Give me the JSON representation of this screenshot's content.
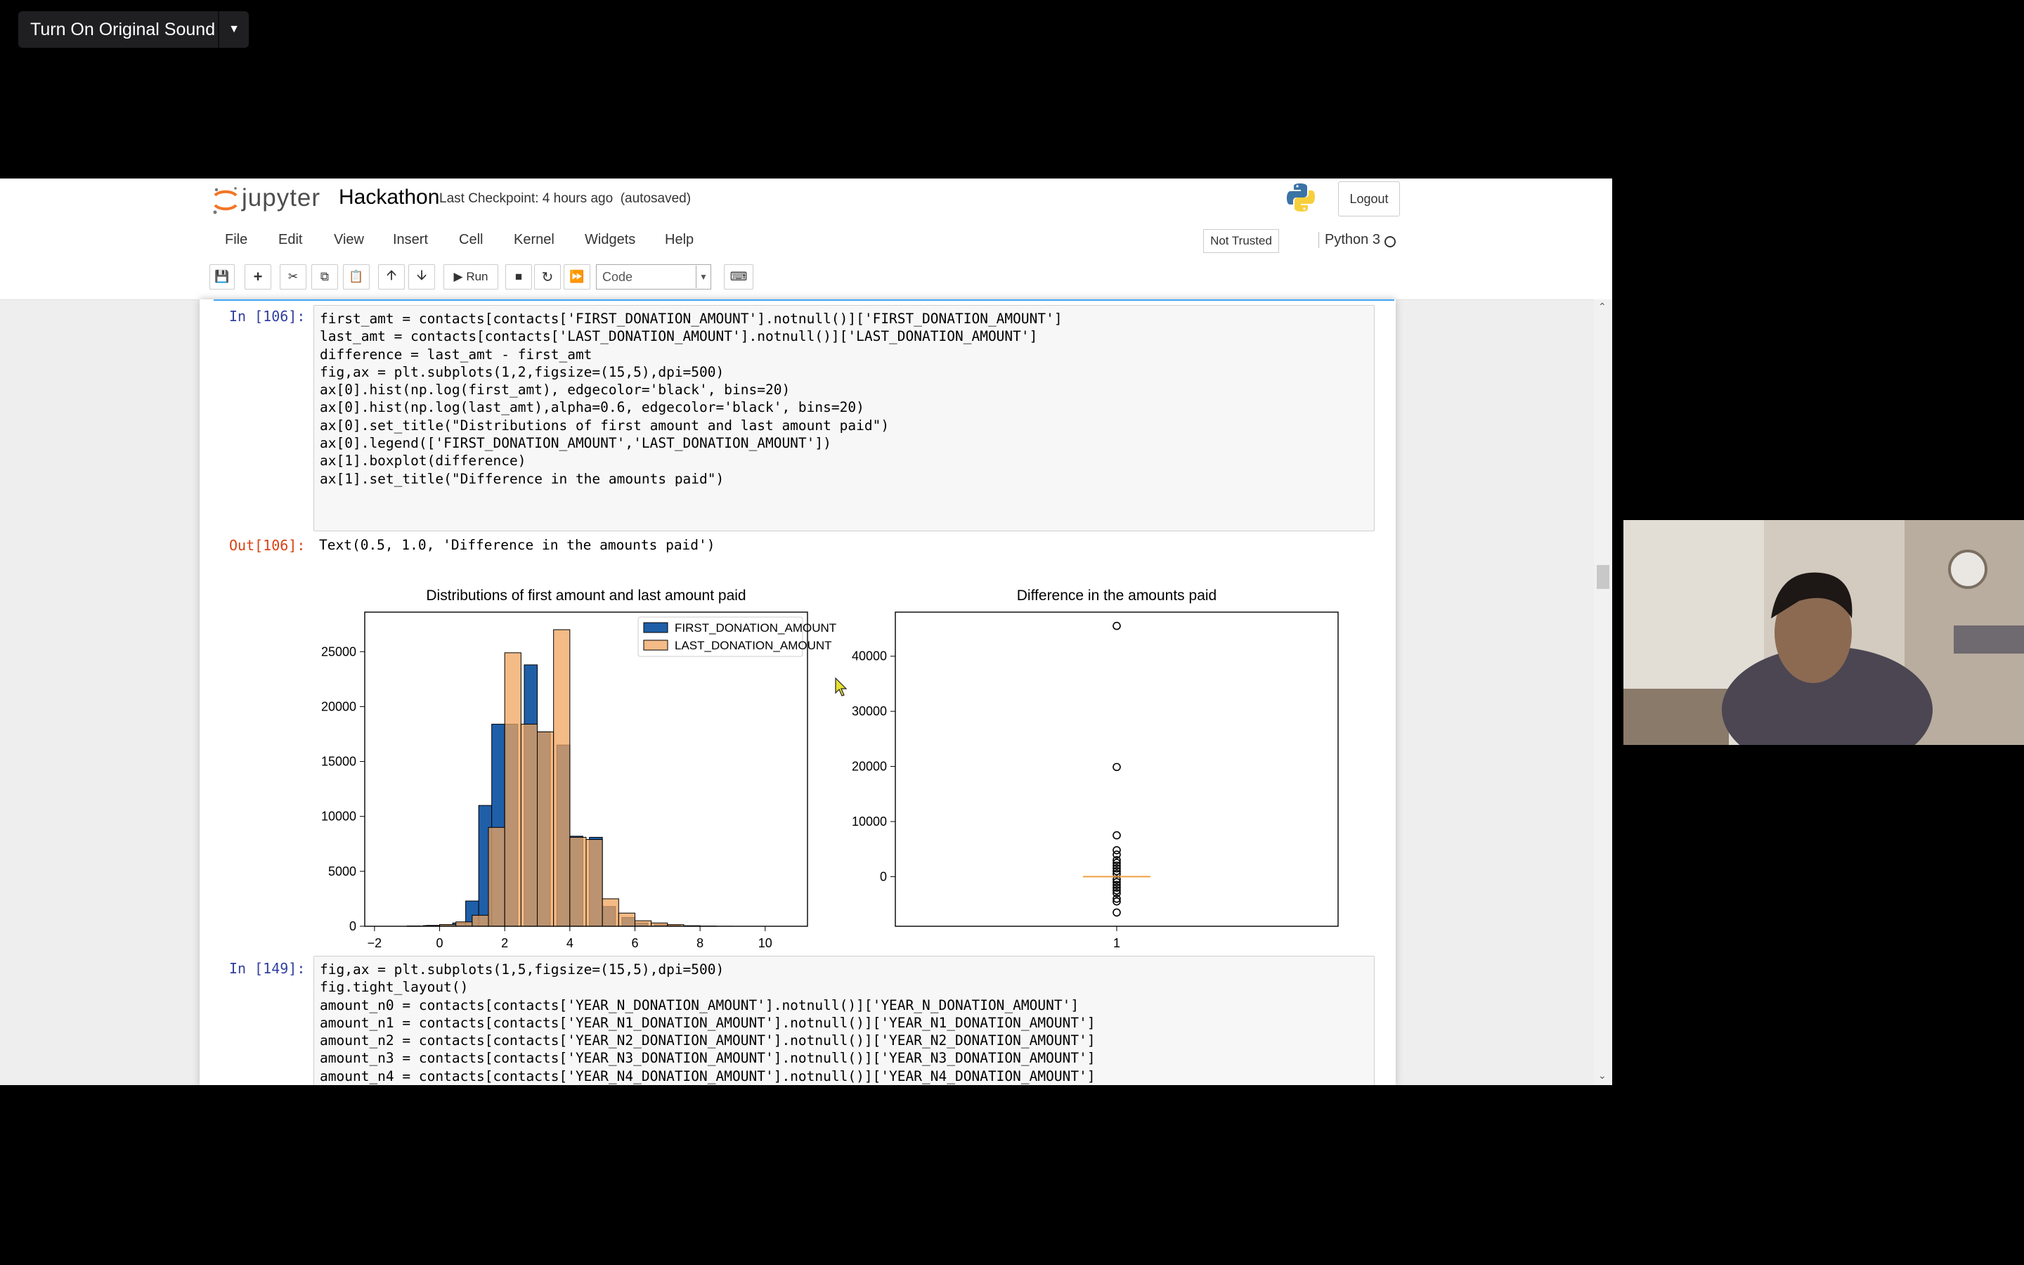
{
  "zoom": {
    "sound_label": "Turn On Original Sound"
  },
  "header": {
    "brand": "jupyter",
    "notebook_name": "Hackathon",
    "checkpoint": "Last Checkpoint: 4 hours ago",
    "autosave": "(autosaved)",
    "logout_label": "Logout"
  },
  "menu": {
    "items": [
      "File",
      "Edit",
      "View",
      "Insert",
      "Cell",
      "Kernel",
      "Widgets",
      "Help"
    ],
    "trust": "Not Trusted",
    "kernel": "Python 3"
  },
  "toolbar": {
    "run_label": "Run",
    "cell_type": "Code"
  },
  "cells": [
    {
      "prompt": "In [106]:",
      "code": [
        "first_amt = contacts[contacts['FIRST_DONATION_AMOUNT'].notnull()]['FIRST_DONATION_AMOUNT']",
        "last_amt = contacts[contacts['LAST_DONATION_AMOUNT'].notnull()]['LAST_DONATION_AMOUNT']",
        "difference = last_amt - first_amt",
        "",
        "fig,ax = plt.subplots(1,2,figsize=(15,5),dpi=500)",
        "ax[0].hist(np.log(first_amt), edgecolor='black', bins=20)",
        "ax[0].hist(np.log(last_amt),alpha=0.6, edgecolor='black', bins=20)",
        "ax[0].set_title(\"Distributions of first amount and last amount paid\")",
        "ax[0].legend(['FIRST_DONATION_AMOUNT','LAST_DONATION_AMOUNT'])",
        "",
        "ax[1].boxplot(difference)",
        "ax[1].set_title(\"Difference in the amounts paid\")"
      ],
      "out_prompt": "Out[106]:",
      "out_text": "Text(0.5, 1.0, 'Difference in the amounts paid')"
    },
    {
      "prompt": "In [149]:",
      "code": [
        "fig,ax = plt.subplots(1,5,figsize=(15,5),dpi=500)",
        "fig.tight_layout()",
        "amount_n0 = contacts[contacts['YEAR_N_DONATION_AMOUNT'].notnull()]['YEAR_N_DONATION_AMOUNT']",
        "amount_n1 = contacts[contacts['YEAR_N1_DONATION_AMOUNT'].notnull()]['YEAR_N1_DONATION_AMOUNT']",
        "amount_n2 = contacts[contacts['YEAR_N2_DONATION_AMOUNT'].notnull()]['YEAR_N2_DONATION_AMOUNT']",
        "amount_n3 = contacts[contacts['YEAR_N3_DONATION_AMOUNT'].notnull()]['YEAR_N3_DONATION_AMOUNT']",
        "amount_n4 = contacts[contacts['YEAR_N4_DONATION_AMOUNT'].notnull()]['YEAR_N4_DONATION_AMOUNT']"
      ]
    }
  ],
  "colors": {
    "first": "#1f5fa8",
    "last": "#f0a45f",
    "median": "#f0a040"
  },
  "chart_data": [
    {
      "type": "bar",
      "title": "Distributions of first amount and last amount paid",
      "xlabel": "",
      "ylabel": "",
      "xlim": [
        -2.3,
        11.3
      ],
      "ylim": [
        0,
        28600
      ],
      "xticks": [
        "-2",
        "0",
        "2",
        "4",
        "6",
        "8",
        "10"
      ],
      "yticks": [
        "0",
        "5000",
        "10000",
        "15000",
        "20000",
        "25000"
      ],
      "legend": "top-right",
      "series": [
        {
          "name": "FIRST_DONATION_AMOUNT",
          "x": [
            -1.6,
            -1.0,
            -0.4,
            0.0,
            0.4,
            0.8,
            1.2,
            1.6,
            2.0,
            2.6,
            3.0,
            3.6,
            4.0,
            4.6,
            5.0,
            5.6,
            6.0,
            6.6,
            7.0,
            7.6,
            8.0
          ],
          "values": [
            0,
            30,
            80,
            150,
            300,
            2300,
            11000,
            18400,
            18400,
            23800,
            17700,
            16500,
            8200,
            8100,
            1800,
            800,
            300,
            150,
            80,
            20,
            5
          ],
          "bin_width": 0.4
        },
        {
          "name": "LAST_DONATION_AMOUNT",
          "x": [
            -1.0,
            -0.5,
            0.0,
            0.5,
            1.0,
            1.5,
            2.0,
            2.5,
            3.0,
            3.5,
            4.0,
            4.5,
            5.0,
            5.5,
            6.0,
            6.5,
            7.0,
            7.5,
            8.0,
            8.5
          ],
          "values": [
            20,
            60,
            150,
            400,
            1000,
            9000,
            24900,
            18400,
            17700,
            27000,
            8100,
            7900,
            2500,
            1200,
            500,
            300,
            150,
            50,
            20,
            5
          ],
          "bin_width": 0.5
        }
      ]
    },
    {
      "type": "boxplot",
      "title": "Difference in the amounts paid",
      "xticks": [
        "1"
      ],
      "ylim": [
        -9000,
        48000
      ],
      "yticks": [
        "0",
        "10000",
        "20000",
        "30000",
        "40000"
      ],
      "median": 0,
      "outliers": [
        45500,
        19900,
        7500,
        4800,
        4000,
        3000,
        2500,
        2000,
        1500,
        1000,
        500,
        -500,
        -1000,
        -1500,
        -2000,
        -2500,
        -3000,
        -4000,
        -4500,
        -6500
      ]
    }
  ]
}
